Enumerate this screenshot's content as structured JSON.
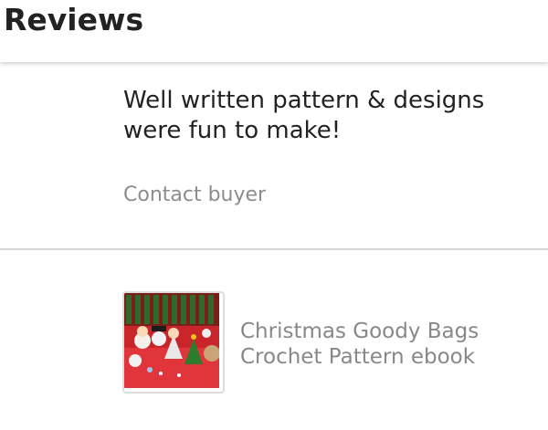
{
  "header": {
    "title": "Reviews"
  },
  "review": {
    "text": "Well written pattern & designs were fun to make!",
    "contact_label": "Contact buyer"
  },
  "item": {
    "title": "Christmas Goody Bags Crochet Pattern ebook"
  },
  "colors": {
    "text_primary": "#222222",
    "text_muted": "#8c8c8c",
    "divider": "#d5d5d5",
    "thumb_red": "#d02a2a"
  }
}
